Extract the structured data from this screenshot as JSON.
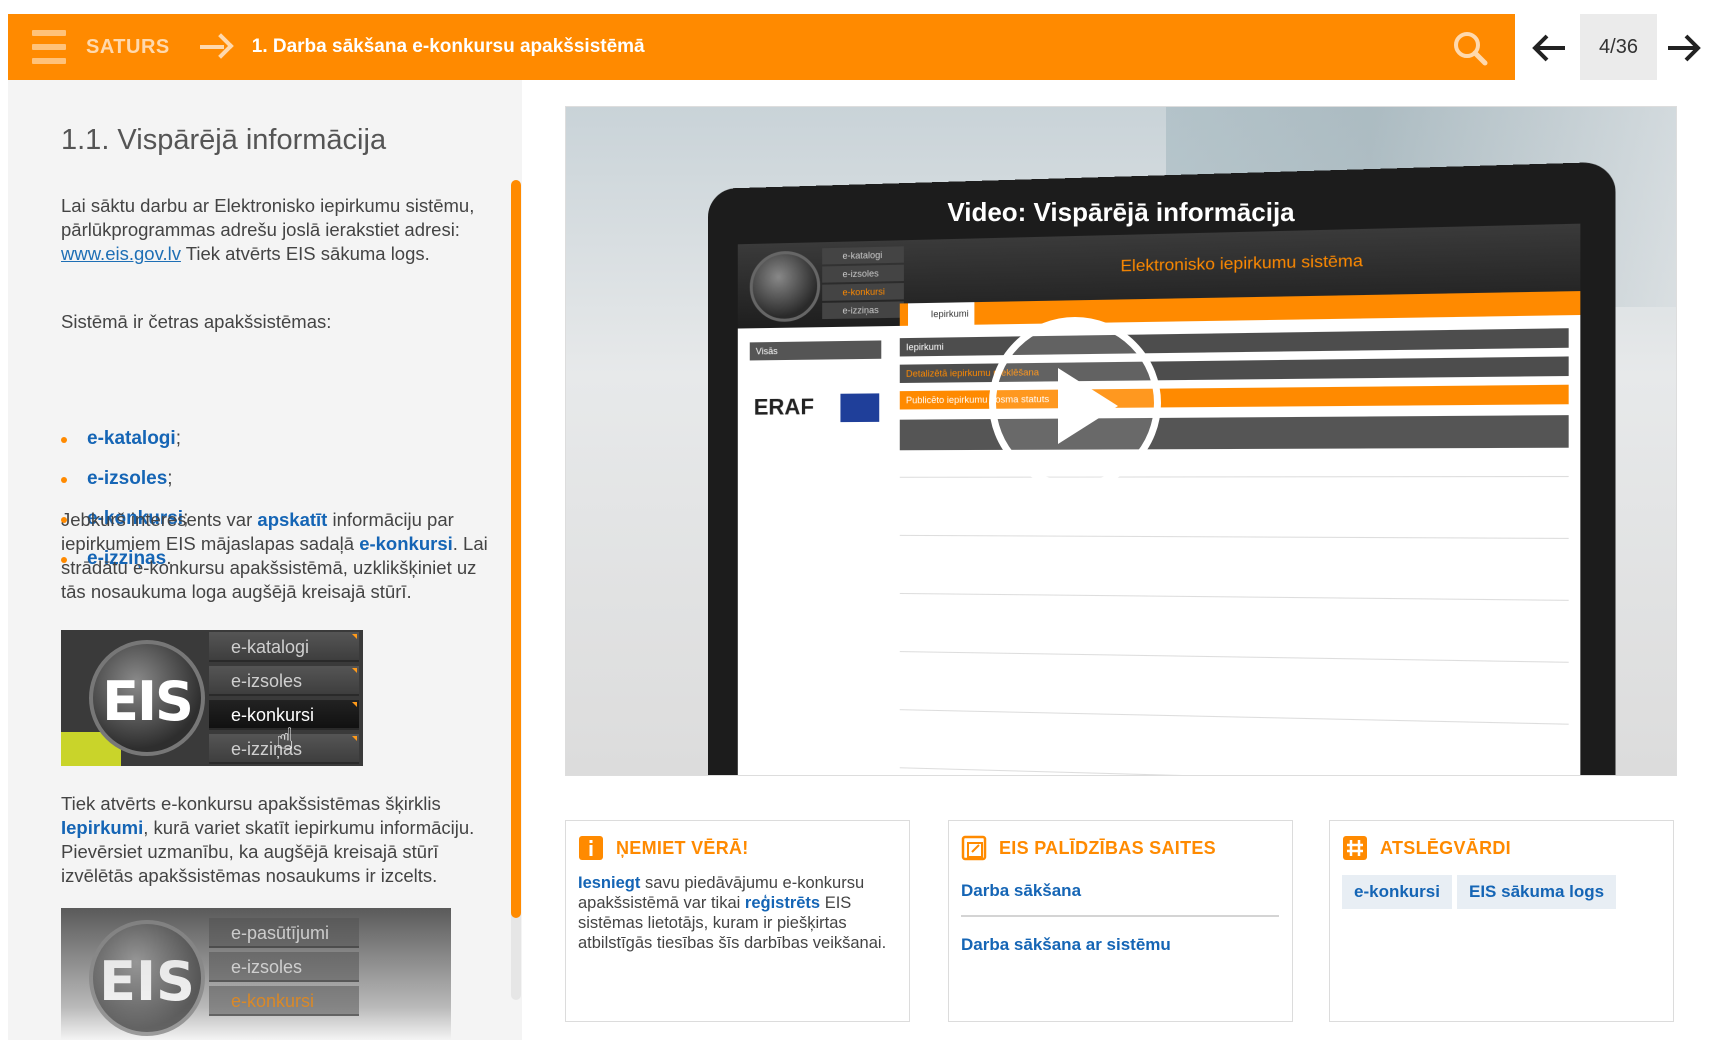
{
  "header": {
    "menu_label": "SATURS",
    "breadcrumb_title": "1. Darba sākšana e-konkursu apakšsistēmā",
    "page_counter": "4/36"
  },
  "section": {
    "title": "1.1. Vispārējā informācija",
    "p1_a": "Lai sāktu darbu ar Elektronisko iepirkumu sistēmu, pārlūkprogrammas adrešu joslā ierakstiet adresi: ",
    "p1_link": "www.eis.gov.lv",
    "p1_b": " Tiek atvērts EIS sākuma logs.",
    "p2": "Sistēmā ir četras apakšsistēmas:",
    "subsystems": [
      {
        "name": "e-katalogi",
        "suffix": ";"
      },
      {
        "name": "e-izsoles",
        "suffix": ";"
      },
      {
        "name": "e-konkursi",
        "suffix": ";"
      },
      {
        "name": "e-izziņas",
        "suffix": "."
      }
    ],
    "p3_a": "Jebkurš interesents var ",
    "p3_hl1": "apskatīt",
    "p3_b": " informāciju par iepirkumiem EIS mājaslapas sadaļā ",
    "p3_hl2": "e-konkursi",
    "p3_c": ". Lai strādātu e-konkursu apakšsistēmā, uzklikšķiniet uz tās nosaukuma loga augšējā kreisajā stūrī.",
    "p4_a": "Tiek atvērts e-konkursu apakšsistēmas šķirklis ",
    "p4_hl": "Iepirkumi",
    "p4_b": ", kurā variet skatīt iepirkumu informāciju. Pievērsiet uzmanību, ka augšējā kreisajā stūrī izvēlētās apakšsistēmas nosaukums ir izcelts."
  },
  "eis_image": {
    "logo_text": "EIS",
    "menu": [
      "e-katalogi",
      "e-izsoles",
      "e-konkursi",
      "e-izziņas"
    ]
  },
  "eis_image2": {
    "menu": [
      "e-pasūtījumi",
      "e-izsoles",
      "e-konkursi"
    ]
  },
  "video": {
    "title": "Video: Vispārējā informācija",
    "screen_site": "Elektronisko iepirkumu sistēma",
    "screen_tab": "Iepirkumi",
    "screen_menu": [
      "e-katalogi",
      "e-izsoles",
      "e-konkursi",
      "e-izziņas"
    ],
    "screen_search": "Visās",
    "screen_bar1": "Iepirkumi",
    "screen_bar2": "Detalizētā iepirkumu meklēšana",
    "screen_bar3": "Publicēto iepirkumu posma statuts",
    "screen_eraf": "ERAF"
  },
  "box_note": {
    "title": "ŅEMIET VĒRĀ!",
    "hl1": "Iesniegt",
    "text_a": " savu piedāvājumu e-konkursu apakšsistēmā var tikai ",
    "hl2": "reģistrēts",
    "text_b": " EIS sistēmas lietotājs, kuram ir piešķirtas atbilstīgās tiesības šīs darbības veikšanai."
  },
  "box_help": {
    "title": "EIS PALĪDZĪBAS SAITES",
    "links": [
      "Darba sākšana",
      "Darba sākšana ar sistēmu"
    ]
  },
  "box_keywords": {
    "title": "ATSLĒGVĀRDI",
    "tags": [
      "e-konkursi",
      "EIS sākuma logs"
    ]
  },
  "colors": {
    "accent": "#ff8a00",
    "link": "#1565b5"
  }
}
